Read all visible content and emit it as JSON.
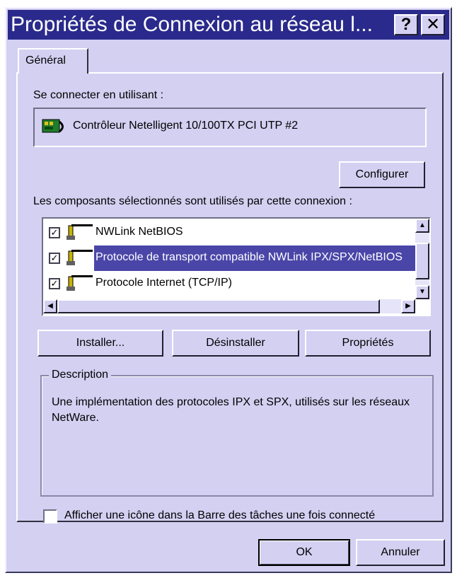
{
  "window": {
    "title": "Propriétés de Connexion au réseau l...",
    "help_label": "?",
    "close_label": "✕"
  },
  "tabs": [
    {
      "label": "Général",
      "active": true
    }
  ],
  "connect": {
    "label": "Se connecter en utilisant :",
    "adapter": "Contrôleur Netelligent 10/100TX PCI UTP #2",
    "configure_label": "Configurer"
  },
  "components": {
    "label": "Les composants sélectionnés sont utilisés par cette connexion :",
    "items": [
      {
        "label": "NWLink NetBIOS",
        "checked": true,
        "selected": false
      },
      {
        "label": "Protocole de transport compatible NWLink IPX/SPX/NetBIOS",
        "checked": true,
        "selected": true
      },
      {
        "label": "Protocole Internet (TCP/IP)",
        "checked": true,
        "selected": false
      }
    ]
  },
  "actions": {
    "install": "Installer...",
    "uninstall": "Désinstaller",
    "properties": "Propriétés"
  },
  "description": {
    "title": "Description",
    "text": "Une implémentation des protocoles IPX et SPX, utilisés sur les réseaux NetWare."
  },
  "tray_option": {
    "label": "Afficher une icône dans la Barre des tâches une fois connecté",
    "checked": false
  },
  "footer": {
    "ok": "OK",
    "cancel": "Annuler"
  },
  "colors": {
    "titlebar": "#2a2a8c",
    "face": "#d4d0f2",
    "selection": "#4a46a8"
  }
}
